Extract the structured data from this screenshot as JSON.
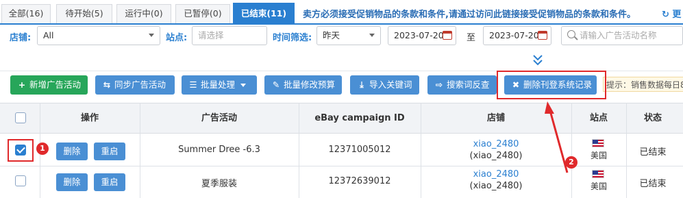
{
  "tabs": [
    {
      "label": "全部(16)"
    },
    {
      "label": "待开始(5)"
    },
    {
      "label": "运行中(0)"
    },
    {
      "label": "已暂停(0)"
    },
    {
      "label": "已结束(11)"
    }
  ],
  "notice": "卖方必须接受促销物品的条款和条件,请通过访问此链接接受促销物品的条款和条件。",
  "notice_icon": "↻ 更",
  "filters": {
    "shop_label": "店铺:",
    "shop_value": "All",
    "site_label": "站点:",
    "site_placeholder": "请选择",
    "time_label": "时间筛选:",
    "time_value": "昨天",
    "date_start": "2023-07-20",
    "date_sep": "至",
    "date_end": "2023-07-20",
    "search_placeholder": "请输入广告活动名称"
  },
  "toolbar": {
    "add": {
      "icon": "+",
      "label": "新增广告活动"
    },
    "sync": {
      "icon": "⇆",
      "label": "同步广告活动"
    },
    "batch": {
      "icon": "☰",
      "label": "批量处理"
    },
    "budget": {
      "icon": "✎",
      "label": "批量修改预算"
    },
    "import": {
      "icon": "⤓",
      "label": "导入关键词"
    },
    "reverse": {
      "icon": "⇨",
      "label": "搜索词反查"
    },
    "delete_records": {
      "icon": "✖",
      "label": "删除刊登系统记录"
    },
    "hint": "提示：销售数据每日8"
  },
  "table": {
    "headers": [
      "操作",
      "广告活动",
      "eBay campaign ID",
      "店铺",
      "站点",
      "状态"
    ],
    "delete_label": "删除",
    "restart_label": "重启",
    "rows": [
      {
        "checked": true,
        "campaign": "Summer Dree -6.3",
        "id": "12371005012",
        "shop": "xiao_2480",
        "shop_sub": "(xiao_2480)",
        "site": "美国",
        "status": "已结束"
      },
      {
        "checked": false,
        "campaign": "夏季服装",
        "id": "12372639012",
        "shop": "xiao_2480",
        "shop_sub": "(xiao_2480)",
        "site": "美国",
        "status": "已结束"
      }
    ]
  },
  "markers": {
    "one": "1",
    "two": "2"
  },
  "colors": {
    "accent": "#2a7fd0",
    "button": "#4a8fd4",
    "add_button": "#27a65a",
    "highlight": "#e0292b"
  }
}
